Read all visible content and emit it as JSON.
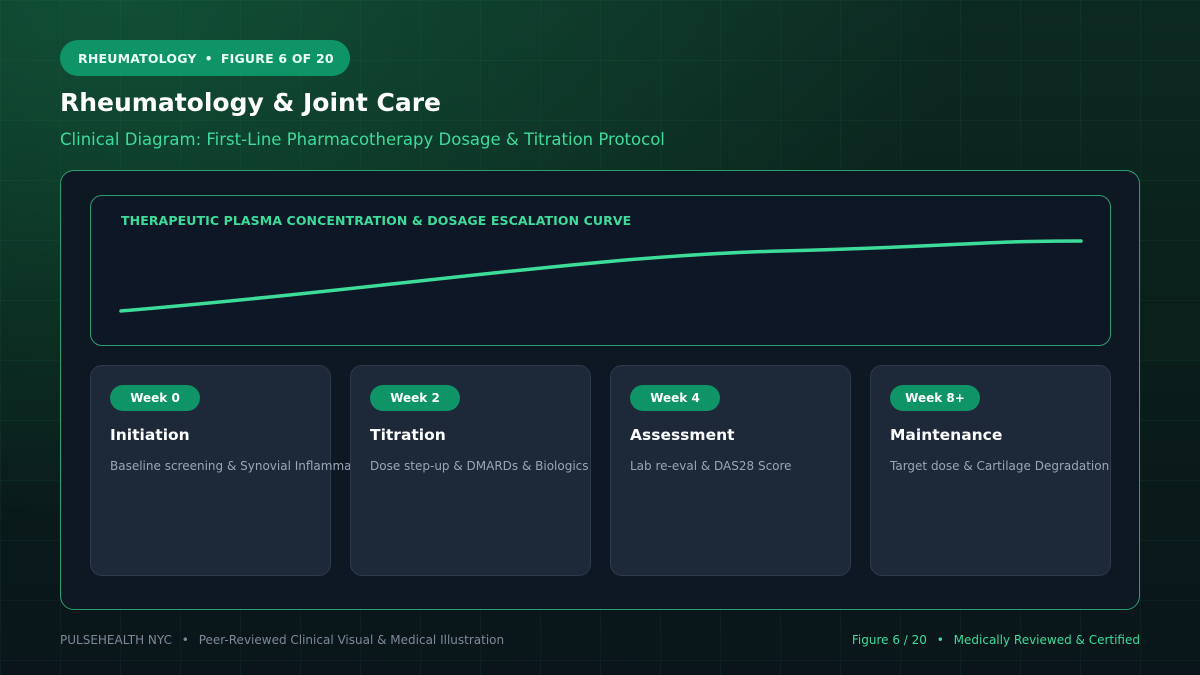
{
  "header": {
    "category": "RHEUMATOLOGY",
    "figure_label": "FIGURE 6 OF 20",
    "title": "Rheumatology & Joint Care",
    "subtitle": "Clinical Diagram: First-Line Pharmacotherapy Dosage & Titration Protocol"
  },
  "chart": {
    "title": "THERAPEUTIC PLASMA CONCENTRATION & DOSAGE ESCALATION CURVE",
    "line_color": "#3ddc9a"
  },
  "phases": [
    {
      "badge": "Week 0",
      "title": "Initiation",
      "desc": "Baseline screening & Synovial Inflammation"
    },
    {
      "badge": "Week 2",
      "title": "Titration",
      "desc": "Dose step-up & DMARDs & Biologics"
    },
    {
      "badge": "Week 4",
      "title": "Assessment",
      "desc": "Lab re-eval & DAS28 Score"
    },
    {
      "badge": "Week 8+",
      "title": "Maintenance",
      "desc": "Target dose & Cartilage Degradation"
    }
  ],
  "footer": {
    "brand": "PULSEHEALTH NYC",
    "tagline": "Peer-Reviewed Clinical Visual & Medical Illustration",
    "figure": "Figure 6 / 20",
    "certification": "Medically Reviewed & Certified"
  },
  "colors": {
    "accent": "#0e9466",
    "accent_text": "#3ddc9a",
    "card_bg": "#1d2838"
  }
}
